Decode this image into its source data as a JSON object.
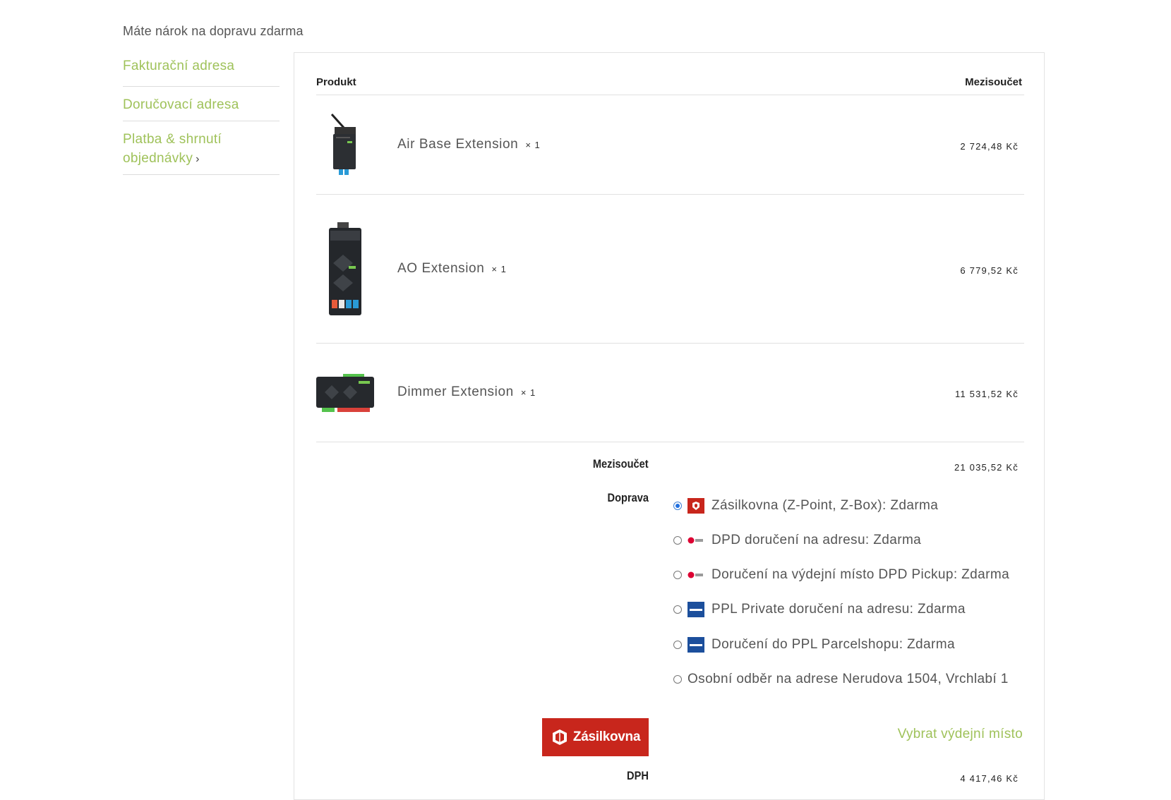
{
  "notice": "Máte nárok na dopravu zdarma",
  "steps": {
    "billing": "Fakturační adresa",
    "delivery": "Doručovací adresa",
    "payment_line1": "Platba & shrnutí",
    "payment_line2": "objednávky",
    "payment_chevron": "›"
  },
  "table": {
    "col_product": "Produkt",
    "col_subtotal": "Mezisoučet"
  },
  "products": [
    {
      "name": "Air Base Extension",
      "qty": "× 1",
      "price": "2 724,48 Kč"
    },
    {
      "name": "AO Extension",
      "qty": "× 1",
      "price": "6 779,52 Kč"
    },
    {
      "name": "Dimmer Extension",
      "qty": "× 1",
      "price": "11 531,52 Kč"
    }
  ],
  "totals": {
    "subtotal_label": "Mezisoučet",
    "subtotal_value": "21 035,52 Kč",
    "shipping_label": "Doprava",
    "vat_label": "DPH",
    "vat_value": "4 417,46 Kč"
  },
  "shipping_options": [
    {
      "label": "Zásilkovna (Z-Point, Z-Box): Zdarma",
      "icon": "zasilkovna-logo-icon",
      "checked": true
    },
    {
      "label": "DPD doručení na adresu: Zdarma",
      "icon": "dpd-logo-icon",
      "checked": false
    },
    {
      "label": "Doručení na výdejní místo DPD Pickup: Zdarma",
      "icon": "dpd-logo-icon",
      "checked": false
    },
    {
      "label": "PPL Private doručení na adresu: Zdarma",
      "icon": "ppl-logo-icon",
      "checked": false
    },
    {
      "label": "Doručení do PPL Parcelshopu: Zdarma",
      "icon": "ppl-logo-icon",
      "checked": false
    },
    {
      "label": "Osobní odběr na adrese Nerudova 1504, Vrchlabí 1",
      "icon": "",
      "checked": false
    }
  ],
  "pickup": {
    "button_label": "Zásilkovna",
    "link_label": "Vybrat výdejní místo"
  },
  "colors": {
    "accent_green": "#9fc25a",
    "zasilkovna_red": "#c8261c",
    "dpd_red": "#dc0032",
    "ppl_blue": "#1c4f9c"
  }
}
